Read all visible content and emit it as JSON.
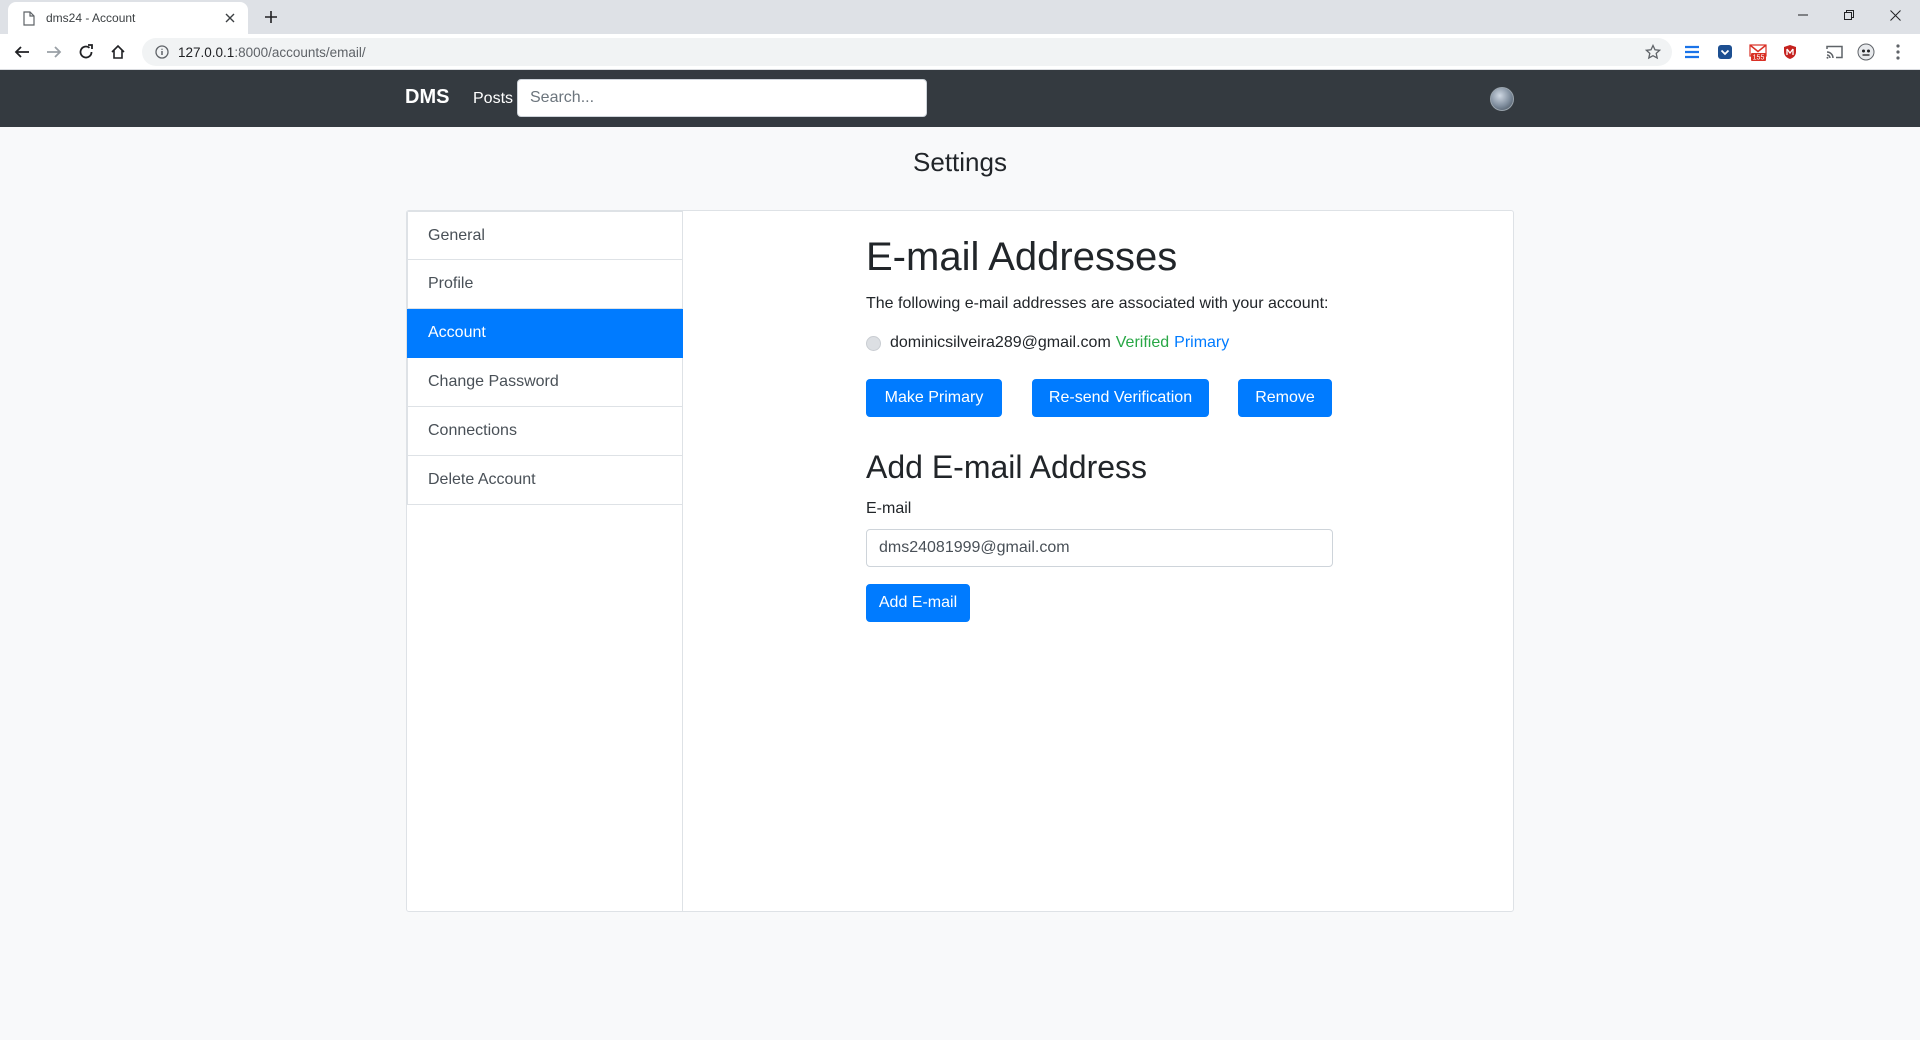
{
  "browser": {
    "tab_title": "dms24 - Account",
    "url_host": "127.0.0.1",
    "url_rest": ":8000/accounts/email/",
    "gmail_badge": "155"
  },
  "navbar": {
    "brand": "DMS",
    "posts_link": "Posts",
    "search_placeholder": "Search..."
  },
  "page": {
    "title": "Settings"
  },
  "sidebar": {
    "items": [
      {
        "label": "General"
      },
      {
        "label": "Profile"
      },
      {
        "label": "Account"
      },
      {
        "label": "Change Password"
      },
      {
        "label": "Connections"
      },
      {
        "label": "Delete Account"
      }
    ],
    "active": "Account"
  },
  "email_section": {
    "heading": "E-mail Addresses",
    "description": "The following e-mail addresses are associated with your account:",
    "address": "dominicsilveira289@gmail.com",
    "verified_label": "Verified",
    "primary_label": "Primary",
    "make_primary_button": "Make Primary",
    "resend_button": "Re-send Verification",
    "remove_button": "Remove"
  },
  "add_section": {
    "heading": "Add E-mail Address",
    "field_label": "E-mail",
    "field_value": "dms24081999@gmail.com",
    "submit_button": "Add E-mail"
  },
  "colors": {
    "navbar_bg": "#343a40",
    "accent": "#007bff",
    "verified": "#28a745"
  }
}
